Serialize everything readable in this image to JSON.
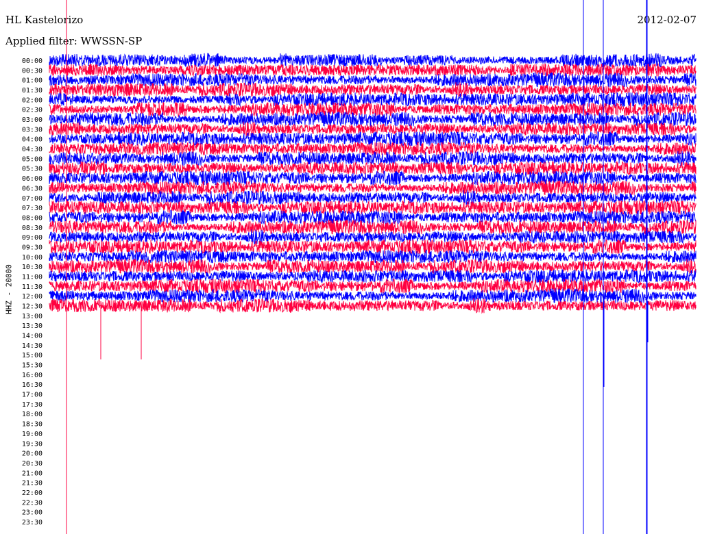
{
  "header": {
    "station": "HL Kastelorizo",
    "date": "2012-02-07",
    "filter": "Applied filter: WWSSN-SP"
  },
  "colors": {
    "trace_a": "#0000ff",
    "trace_b": "#ff0040",
    "background": "#ffffff"
  },
  "chart_data": {
    "type": "line",
    "title": "HL Kastelorizo",
    "ylabel": "HHZ - 20000",
    "row_labels": [
      "00:00",
      "00:30",
      "01:00",
      "01:30",
      "02:00",
      "02:30",
      "03:00",
      "03:30",
      "04:00",
      "04:30",
      "05:00",
      "05:30",
      "06:00",
      "06:30",
      "07:00",
      "07:30",
      "08:00",
      "08:30",
      "09:00",
      "09:30",
      "10:00",
      "10:30",
      "11:00",
      "11:30",
      "12:00",
      "12:30",
      "13:00",
      "13:30",
      "14:00",
      "14:30",
      "15:00",
      "15:30",
      "16:00",
      "16:30",
      "17:00",
      "17:30",
      "18:00",
      "18:30",
      "19:00",
      "19:30",
      "20:00",
      "20:30",
      "21:00",
      "21:30",
      "22:00",
      "22:30",
      "23:00",
      "23:30"
    ],
    "rows_with_data": 26,
    "series": [
      {
        "name": "",
        "values": []
      }
    ]
  }
}
